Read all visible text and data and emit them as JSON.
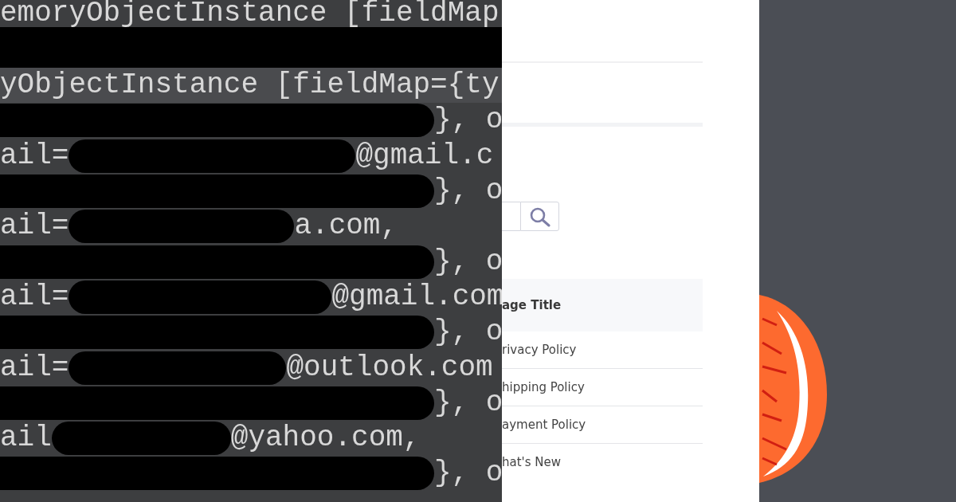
{
  "code_view": {
    "lines": [
      {
        "kind": "cut",
        "text": "emoryObjectInstance [fieldMap"
      },
      {
        "kind": "bar"
      },
      {
        "kind": "text",
        "text": "yObjectInstance [fieldMap={ty"
      },
      {
        "kind": "redacted",
        "after": "}, o"
      },
      {
        "kind": "redacted",
        "before": "ail=",
        "after": "@gmail.c"
      },
      {
        "kind": "redacted",
        "after": "}, o"
      },
      {
        "kind": "redacted",
        "before": "ail=",
        "after": "a.com,"
      },
      {
        "kind": "redacted",
        "after": "}, o"
      },
      {
        "kind": "redacted",
        "before": "ail=",
        "after": "@gmail.com"
      },
      {
        "kind": "redacted",
        "after": "}, o"
      },
      {
        "kind": "redacted",
        "before": "ail=",
        "after": "@outlook.com"
      },
      {
        "kind": "redacted",
        "after": "}, o"
      },
      {
        "kind": "redacted",
        "before": "ail",
        "after": "@yahoo.com,"
      },
      {
        "kind": "redacted",
        "after": "}, o"
      }
    ]
  },
  "page": {
    "table": {
      "columns": [
        "age Title"
      ],
      "rows": [
        "rivacy Policy",
        "hipping Policy",
        "ayment Policy",
        "hat's New"
      ]
    }
  }
}
